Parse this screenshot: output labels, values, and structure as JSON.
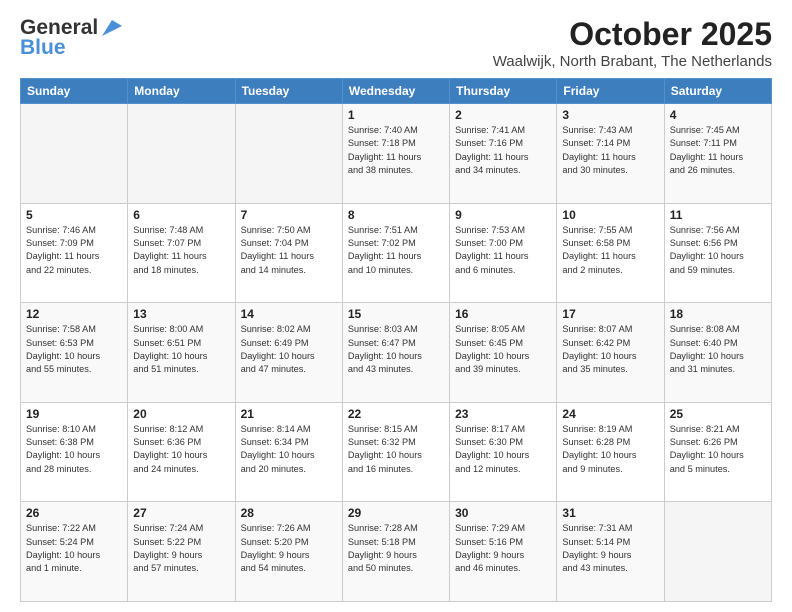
{
  "logo": {
    "general": "General",
    "blue": "Blue"
  },
  "header": {
    "title": "October 2025",
    "subtitle": "Waalwijk, North Brabant, The Netherlands"
  },
  "weekdays": [
    "Sunday",
    "Monday",
    "Tuesday",
    "Wednesday",
    "Thursday",
    "Friday",
    "Saturday"
  ],
  "weeks": [
    [
      {
        "day": "",
        "info": ""
      },
      {
        "day": "",
        "info": ""
      },
      {
        "day": "",
        "info": ""
      },
      {
        "day": "1",
        "info": "Sunrise: 7:40 AM\nSunset: 7:18 PM\nDaylight: 11 hours\nand 38 minutes."
      },
      {
        "day": "2",
        "info": "Sunrise: 7:41 AM\nSunset: 7:16 PM\nDaylight: 11 hours\nand 34 minutes."
      },
      {
        "day": "3",
        "info": "Sunrise: 7:43 AM\nSunset: 7:14 PM\nDaylight: 11 hours\nand 30 minutes."
      },
      {
        "day": "4",
        "info": "Sunrise: 7:45 AM\nSunset: 7:11 PM\nDaylight: 11 hours\nand 26 minutes."
      }
    ],
    [
      {
        "day": "5",
        "info": "Sunrise: 7:46 AM\nSunset: 7:09 PM\nDaylight: 11 hours\nand 22 minutes."
      },
      {
        "day": "6",
        "info": "Sunrise: 7:48 AM\nSunset: 7:07 PM\nDaylight: 11 hours\nand 18 minutes."
      },
      {
        "day": "7",
        "info": "Sunrise: 7:50 AM\nSunset: 7:04 PM\nDaylight: 11 hours\nand 14 minutes."
      },
      {
        "day": "8",
        "info": "Sunrise: 7:51 AM\nSunset: 7:02 PM\nDaylight: 11 hours\nand 10 minutes."
      },
      {
        "day": "9",
        "info": "Sunrise: 7:53 AM\nSunset: 7:00 PM\nDaylight: 11 hours\nand 6 minutes."
      },
      {
        "day": "10",
        "info": "Sunrise: 7:55 AM\nSunset: 6:58 PM\nDaylight: 11 hours\nand 2 minutes."
      },
      {
        "day": "11",
        "info": "Sunrise: 7:56 AM\nSunset: 6:56 PM\nDaylight: 10 hours\nand 59 minutes."
      }
    ],
    [
      {
        "day": "12",
        "info": "Sunrise: 7:58 AM\nSunset: 6:53 PM\nDaylight: 10 hours\nand 55 minutes."
      },
      {
        "day": "13",
        "info": "Sunrise: 8:00 AM\nSunset: 6:51 PM\nDaylight: 10 hours\nand 51 minutes."
      },
      {
        "day": "14",
        "info": "Sunrise: 8:02 AM\nSunset: 6:49 PM\nDaylight: 10 hours\nand 47 minutes."
      },
      {
        "day": "15",
        "info": "Sunrise: 8:03 AM\nSunset: 6:47 PM\nDaylight: 10 hours\nand 43 minutes."
      },
      {
        "day": "16",
        "info": "Sunrise: 8:05 AM\nSunset: 6:45 PM\nDaylight: 10 hours\nand 39 minutes."
      },
      {
        "day": "17",
        "info": "Sunrise: 8:07 AM\nSunset: 6:42 PM\nDaylight: 10 hours\nand 35 minutes."
      },
      {
        "day": "18",
        "info": "Sunrise: 8:08 AM\nSunset: 6:40 PM\nDaylight: 10 hours\nand 31 minutes."
      }
    ],
    [
      {
        "day": "19",
        "info": "Sunrise: 8:10 AM\nSunset: 6:38 PM\nDaylight: 10 hours\nand 28 minutes."
      },
      {
        "day": "20",
        "info": "Sunrise: 8:12 AM\nSunset: 6:36 PM\nDaylight: 10 hours\nand 24 minutes."
      },
      {
        "day": "21",
        "info": "Sunrise: 8:14 AM\nSunset: 6:34 PM\nDaylight: 10 hours\nand 20 minutes."
      },
      {
        "day": "22",
        "info": "Sunrise: 8:15 AM\nSunset: 6:32 PM\nDaylight: 10 hours\nand 16 minutes."
      },
      {
        "day": "23",
        "info": "Sunrise: 8:17 AM\nSunset: 6:30 PM\nDaylight: 10 hours\nand 12 minutes."
      },
      {
        "day": "24",
        "info": "Sunrise: 8:19 AM\nSunset: 6:28 PM\nDaylight: 10 hours\nand 9 minutes."
      },
      {
        "day": "25",
        "info": "Sunrise: 8:21 AM\nSunset: 6:26 PM\nDaylight: 10 hours\nand 5 minutes."
      }
    ],
    [
      {
        "day": "26",
        "info": "Sunrise: 7:22 AM\nSunset: 5:24 PM\nDaylight: 10 hours\nand 1 minute."
      },
      {
        "day": "27",
        "info": "Sunrise: 7:24 AM\nSunset: 5:22 PM\nDaylight: 9 hours\nand 57 minutes."
      },
      {
        "day": "28",
        "info": "Sunrise: 7:26 AM\nSunset: 5:20 PM\nDaylight: 9 hours\nand 54 minutes."
      },
      {
        "day": "29",
        "info": "Sunrise: 7:28 AM\nSunset: 5:18 PM\nDaylight: 9 hours\nand 50 minutes."
      },
      {
        "day": "30",
        "info": "Sunrise: 7:29 AM\nSunset: 5:16 PM\nDaylight: 9 hours\nand 46 minutes."
      },
      {
        "day": "31",
        "info": "Sunrise: 7:31 AM\nSunset: 5:14 PM\nDaylight: 9 hours\nand 43 minutes."
      },
      {
        "day": "",
        "info": ""
      }
    ]
  ]
}
